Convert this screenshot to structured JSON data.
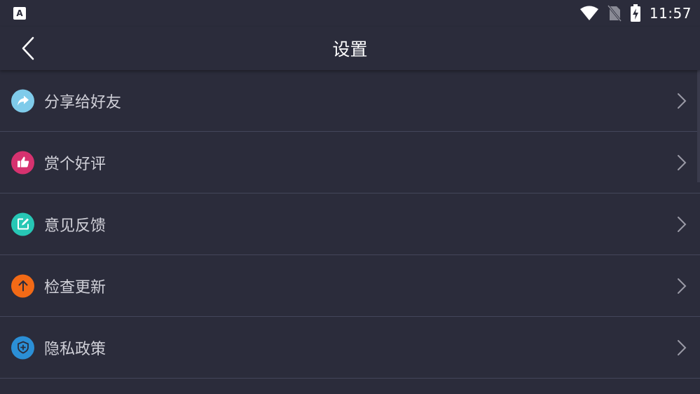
{
  "status_bar": {
    "app_badge": "A",
    "time": "11:57"
  },
  "header": {
    "title": "设置"
  },
  "settings": [
    {
      "label": "分享给好友",
      "icon": "share-icon",
      "color": "#7fcbea"
    },
    {
      "label": "赏个好评",
      "icon": "thumbs-up-icon",
      "color": "#d6326f"
    },
    {
      "label": "意见反馈",
      "icon": "edit-icon",
      "color": "#27c7b5"
    },
    {
      "label": "检查更新",
      "icon": "arrow-up-icon",
      "color": "#f26a16"
    },
    {
      "label": "隐私政策",
      "icon": "shield-icon",
      "color": "#2b8fd6"
    }
  ]
}
